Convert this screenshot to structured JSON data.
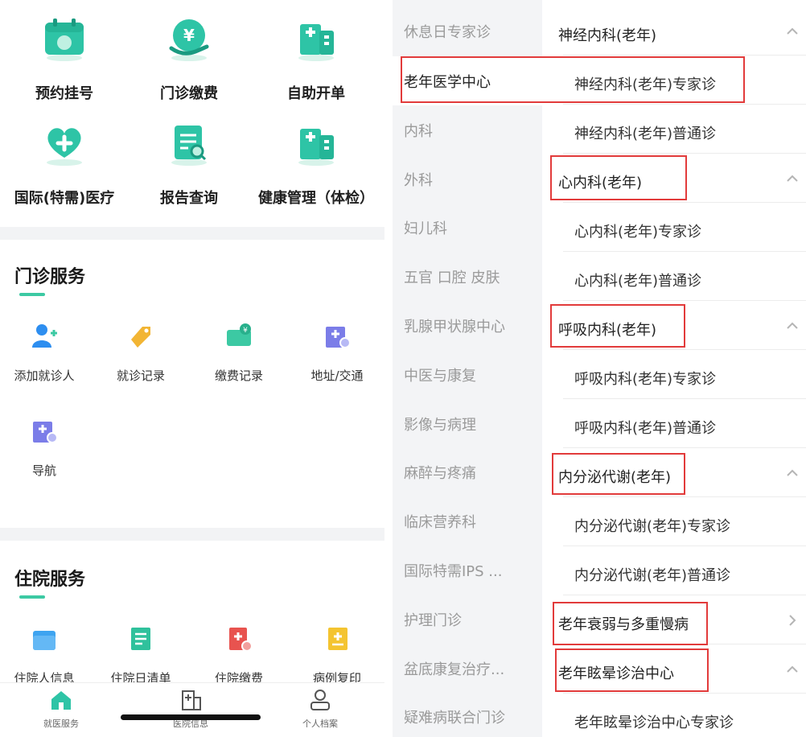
{
  "left": {
    "top_grid": [
      {
        "label": "预约挂号",
        "icon": "calendar-icon"
      },
      {
        "label": "门诊缴费",
        "icon": "yuan-payment-icon"
      },
      {
        "label": "自助开单",
        "icon": "building-icon"
      },
      {
        "label": "国际(特需)医疗",
        "icon": "heart-cross-icon"
      },
      {
        "label": "报告查询",
        "icon": "report-search-icon"
      },
      {
        "label": "健康管理（体检）",
        "icon": "building-icon"
      }
    ],
    "outpatient": {
      "title": "门诊服务",
      "items": [
        {
          "label": "添加就诊人",
          "icon": "add-user-icon"
        },
        {
          "label": "就诊记录",
          "icon": "tag-icon"
        },
        {
          "label": "缴费记录",
          "icon": "payment-card-icon"
        },
        {
          "label": "地址/交通",
          "icon": "hospital-location-icon"
        },
        {
          "label": "导航",
          "icon": "hospital-navigation-icon"
        }
      ]
    },
    "inpatient": {
      "title": "住院服务",
      "items": [
        {
          "label": "住院人信息",
          "icon": "folder-icon"
        },
        {
          "label": "住院日清单",
          "icon": "list-icon"
        },
        {
          "label": "住院缴费",
          "icon": "medical-payment-icon"
        },
        {
          "label": "病例复印",
          "icon": "document-copy-icon"
        }
      ]
    },
    "tabbar": [
      {
        "label": "就医服务",
        "icon": "home-icon"
      },
      {
        "label": "医院信息",
        "icon": "hospital-icon"
      },
      {
        "label": "个人档案",
        "icon": "user-profile-icon"
      }
    ]
  },
  "right": {
    "categories": [
      "休息日专家诊",
      "老年医学中心",
      "内科",
      "外科",
      "妇儿科",
      "五官 口腔 皮肤",
      "乳腺甲状腺中心",
      "中医与康复",
      "影像与病理",
      "麻醉与疼痛",
      "临床营养科",
      "国际特需IPS ...",
      "护理门诊",
      "盆底康复治疗...",
      "疑难病联合门诊"
    ],
    "active_category": "老年医学中心",
    "rows": [
      {
        "text": "神经内科(老年)",
        "kind": "dept",
        "chevron": "up"
      },
      {
        "text": "神经内科(老年)专家诊",
        "kind": "sub"
      },
      {
        "text": "神经内科(老年)普通诊",
        "kind": "sub"
      },
      {
        "text": "心内科(老年)",
        "kind": "dept",
        "chevron": "up"
      },
      {
        "text": "心内科(老年)专家诊",
        "kind": "sub"
      },
      {
        "text": "心内科(老年)普通诊",
        "kind": "sub"
      },
      {
        "text": "呼吸内科(老年)",
        "kind": "dept",
        "chevron": "up"
      },
      {
        "text": "呼吸内科(老年)专家诊",
        "kind": "sub"
      },
      {
        "text": "呼吸内科(老年)普通诊",
        "kind": "sub"
      },
      {
        "text": "内分泌代谢(老年)",
        "kind": "dept",
        "chevron": "up"
      },
      {
        "text": "内分泌代谢(老年)专家诊",
        "kind": "sub"
      },
      {
        "text": "内分泌代谢(老年)普通诊",
        "kind": "sub"
      },
      {
        "text": "老年衰弱与多重慢病",
        "kind": "dept",
        "chevron": "right"
      },
      {
        "text": "老年眩晕诊治中心",
        "kind": "dept",
        "chevron": "up"
      },
      {
        "text": "老年眩晕诊治中心专家诊",
        "kind": "sub"
      }
    ]
  },
  "colors": {
    "accent": "#3cc9a3",
    "highlight": "#e23b3b",
    "sidebar_bg": "#f3f4f6"
  }
}
